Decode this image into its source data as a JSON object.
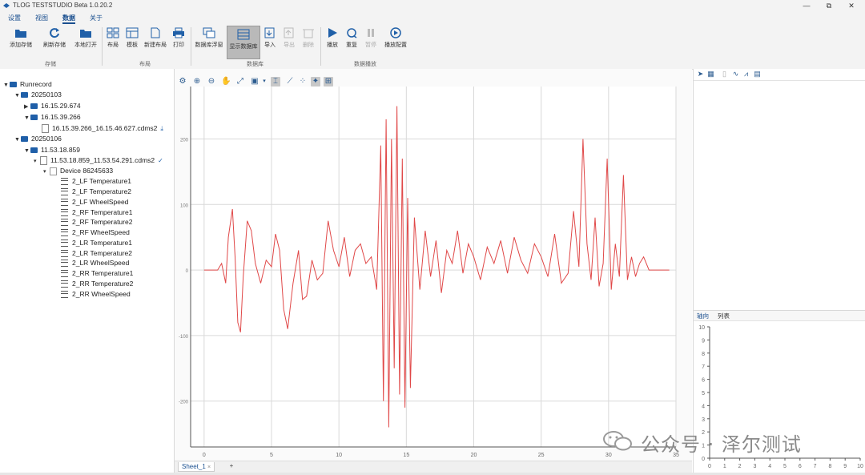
{
  "app": {
    "title": "TLOG TESTSTUDIO Beta 1.0.20.2"
  },
  "window_controls": {
    "minimize": "—",
    "maximize": "⧉",
    "close": "✕"
  },
  "menu": [
    "设置",
    "视图",
    "数据",
    "关于"
  ],
  "menu_active": "数据",
  "ribbon": {
    "buttons": [
      {
        "label": "添加存储",
        "icon": "folder-open-icon",
        "enabled": true
      },
      {
        "label": "刷新存储",
        "icon": "refresh-icon",
        "enabled": true
      },
      {
        "label": "本地打开",
        "icon": "folder-icon",
        "enabled": true
      },
      {
        "label": "布局",
        "icon": "layout-grid-icon",
        "enabled": true
      },
      {
        "label": "模板",
        "icon": "template-icon",
        "enabled": true
      },
      {
        "label": "新建布局",
        "icon": "new-document-icon",
        "enabled": true
      },
      {
        "label": "打印",
        "icon": "print-icon",
        "enabled": true
      },
      {
        "label": "数据库浮窗",
        "icon": "window-stack-icon",
        "enabled": true
      },
      {
        "label": "显示数据库",
        "icon": "database-icon",
        "enabled": true,
        "selected": true
      },
      {
        "label": "导入",
        "icon": "import-icon",
        "enabled": true
      },
      {
        "label": "导出",
        "icon": "export-icon",
        "enabled": false
      },
      {
        "label": "删除",
        "icon": "delete-icon",
        "enabled": false
      },
      {
        "label": "播放",
        "icon": "play-icon",
        "enabled": true
      },
      {
        "label": "重复",
        "icon": "repeat-icon",
        "enabled": true
      },
      {
        "label": "暂停",
        "icon": "pause-icon",
        "enabled": false
      },
      {
        "label": "播放配置",
        "icon": "playback-settings-icon",
        "enabled": true
      }
    ],
    "groups": [
      "存储",
      "布局",
      "数据库",
      "数据播放"
    ]
  },
  "tree": {
    "root": "Runrecord",
    "folders": [
      {
        "label": "20250103",
        "children": [
          {
            "label": "16.15.29.674",
            "expanded": false
          },
          {
            "label": "16.15.39.266",
            "expanded": true,
            "file": "16.15.39.266_16.15.46.627.cdms2"
          }
        ]
      },
      {
        "label": "20250106",
        "children": [
          {
            "label": "11.53.18.859",
            "expanded": true,
            "file": "11.53.18.859_11.53.54.291.cdms2",
            "device": "Device  86245633",
            "channels": [
              "2_LF Temperature1",
              "2_LF Temperature2",
              "2_LF WheelSpeed",
              "2_RF Temperature1",
              "2_RF Temperature2",
              "2_RF WheelSpeed",
              "2_LR Temperature1",
              "2_LR Temperature2",
              "2_LR WheelSpeed",
              "2_RR Temperature1",
              "2_RR Temperature2",
              "2_RR WheelSpeed"
            ]
          }
        ]
      }
    ]
  },
  "chart_toolbar_icons": [
    "settings-icon",
    "zoom-in-icon",
    "zoom-out-icon",
    "pan-icon",
    "zoom-fit-icon",
    "screenshot-icon",
    "dropdown-icon",
    "cursor-icon",
    "line-mode-icon",
    "scatter-mode-icon",
    "highlight-icon",
    "ruler-icon"
  ],
  "sheet": {
    "tab": "Sheet_1",
    "add": "+"
  },
  "right_panel": {
    "toolbar_icons": [
      "pin-icon",
      "image-icon",
      "document-icon",
      "wave-icon",
      "chart-icon",
      "table-icon"
    ],
    "tabs": [
      "轴向",
      "列表"
    ],
    "mini_axis": {
      "y_ticks": [
        "0",
        "1",
        "2",
        "3",
        "4",
        "5",
        "6",
        "7",
        "8",
        "9",
        "10"
      ],
      "x_ticks": [
        "0",
        "1",
        "2",
        "3",
        "4",
        "5",
        "6",
        "7",
        "8",
        "9",
        "10"
      ]
    }
  },
  "watermark": {
    "text": "公众号 · 泽尔测试"
  },
  "chart_data": {
    "type": "line",
    "xlim": [
      -1,
      35
    ],
    "ylim": [
      -270,
      280
    ],
    "x_ticks": [
      "0",
      "5",
      "10",
      "15",
      "20",
      "25",
      "30",
      "35"
    ],
    "y_ticks": [
      "200",
      "100",
      "0",
      "-100",
      "-200"
    ],
    "grid": true,
    "series_color": "#e04848",
    "series": [
      {
        "x": [
          0.0,
          1.0,
          1.3,
          1.6,
          1.8,
          2.1,
          2.3,
          2.5,
          2.7,
          2.9,
          3.2,
          3.5,
          3.8,
          4.2,
          4.6,
          5.0,
          5.3,
          5.6,
          5.9,
          6.2,
          6.6,
          7.0,
          7.3,
          7.6,
          8.0,
          8.4,
          8.8,
          9.2,
          9.6,
          10.0,
          10.4,
          10.8,
          11.2,
          11.6,
          12.0,
          12.4,
          12.8,
          13.1,
          13.3,
          13.5,
          13.7,
          13.9,
          14.1,
          14.3,
          14.5,
          14.7,
          14.9,
          15.1,
          15.3,
          15.6,
          16.0,
          16.4,
          16.8,
          17.2,
          17.6,
          18.0,
          18.4,
          18.8,
          19.2,
          19.6,
          20.0,
          20.5,
          21.0,
          21.5,
          22.0,
          22.5,
          23.0,
          23.5,
          24.0,
          24.5,
          25.0,
          25.5,
          26.0,
          26.5,
          27.0,
          27.4,
          27.8,
          28.1,
          28.4,
          28.7,
          29.0,
          29.3,
          29.6,
          29.9,
          30.2,
          30.5,
          30.8,
          31.1,
          31.4,
          31.7,
          32.0,
          32.3,
          32.6,
          33.0,
          33.5,
          34.0,
          34.5
        ],
        "y": [
          0,
          0,
          10,
          -20,
          50,
          93,
          20,
          -80,
          -95,
          -10,
          75,
          60,
          10,
          -20,
          15,
          5,
          55,
          30,
          -60,
          -90,
          -20,
          30,
          -45,
          -40,
          15,
          -15,
          -5,
          75,
          30,
          5,
          50,
          -10,
          30,
          40,
          10,
          20,
          -30,
          190,
          -200,
          230,
          -240,
          200,
          -150,
          250,
          -190,
          170,
          -210,
          110,
          -180,
          80,
          -30,
          60,
          -10,
          45,
          -35,
          30,
          10,
          60,
          -5,
          40,
          20,
          -15,
          35,
          10,
          45,
          -5,
          50,
          15,
          -5,
          40,
          20,
          -10,
          55,
          -20,
          -5,
          90,
          5,
          200,
          40,
          -15,
          80,
          -25,
          10,
          170,
          -30,
          40,
          -10,
          145,
          -15,
          20,
          -10,
          10,
          20,
          0,
          0,
          0,
          0
        ]
      }
    ]
  }
}
